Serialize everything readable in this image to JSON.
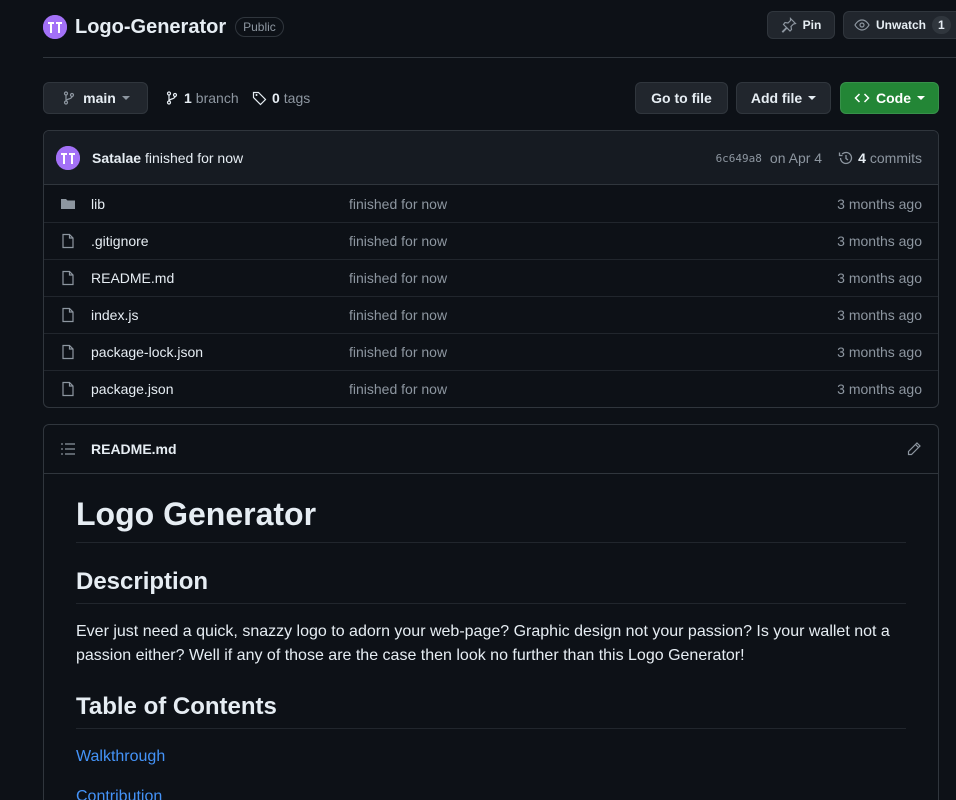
{
  "repo": {
    "name": "Logo-Generator",
    "visibility": "Public"
  },
  "header_actions": {
    "pin_label": "Pin",
    "watch_label": "Unwatch",
    "watch_count": "1"
  },
  "toolbar": {
    "branch": "main",
    "branches_count": "1",
    "branches_label": "branch",
    "tags_count": "0",
    "tags_label": "tags",
    "goto_file": "Go to file",
    "add_file": "Add file",
    "code": "Code"
  },
  "commit": {
    "author": "Satalae",
    "message": "finished for now",
    "sha": "6c649a8",
    "date": "on Apr 4",
    "commits_count": "4",
    "commits_label": "commits"
  },
  "files": [
    {
      "name": "lib",
      "type": "folder",
      "message": "finished for now",
      "age": "3 months ago"
    },
    {
      "name": ".gitignore",
      "type": "file",
      "message": "finished for now",
      "age": "3 months ago"
    },
    {
      "name": "README.md",
      "type": "file",
      "message": "finished for now",
      "age": "3 months ago"
    },
    {
      "name": "index.js",
      "type": "file",
      "message": "finished for now",
      "age": "3 months ago"
    },
    {
      "name": "package-lock.json",
      "type": "file",
      "message": "finished for now",
      "age": "3 months ago"
    },
    {
      "name": "package.json",
      "type": "file",
      "message": "finished for now",
      "age": "3 months ago"
    }
  ],
  "readme": {
    "filename": "README.md",
    "h1": "Logo Generator",
    "description_heading": "Description",
    "description": "Ever just need a quick, snazzy logo to adorn your web-page? Graphic design not your passion? Is your wallet not a passion either? Well if any of those are the case then look no further than this Logo Generator!",
    "toc_heading": "Table of Contents",
    "toc_links": [
      "Walkthrough",
      "Contribution"
    ]
  },
  "colors": {
    "accent_green": "#238636",
    "link_blue": "#4493f8",
    "avatar_purple": "#a371f7"
  }
}
